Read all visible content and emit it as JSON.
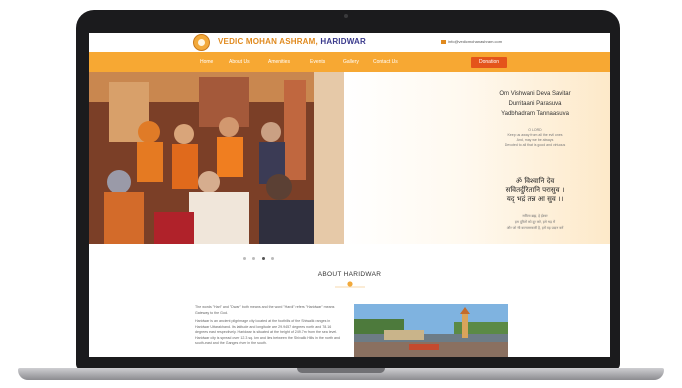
{
  "header": {
    "brand_main": "VEDIC MOHAN ASHRAM,",
    "brand_sub": " HARIDWAR",
    "email": "info@vedicmohanashram.com"
  },
  "nav": {
    "items": [
      "Home",
      "About Us",
      "Amenities",
      "Events",
      "Gallery",
      "Contact Us"
    ],
    "donate_label": "Donation"
  },
  "hero": {
    "mantra_english": [
      "Om Vishwani Deva Savitar",
      "Durritaani Parasuva",
      "Yadbhadram Tannaasuva"
    ],
    "meaning_lines": [
      "O LORD",
      "Keep us away from all the evil ones",
      "And, may we be always",
      "Devoted to all that is good and virtuous"
    ],
    "mantra_sanskrit": [
      "ॐ विश्वानि देव",
      "सवितर्दुरितानि परासुव ।",
      "यद् भद्रं तन्न आ सुव ।।"
    ],
    "sanskrit_meaning": [
      "सविता ब्रह्म, हे ईश्वर",
      "हम दूरितों को दूर करे, हमे भद्र में",
      "और जो भी कल्याणकारी है, हमें वह प्रदान करें"
    ]
  },
  "about": {
    "title": "ABOUT HARIDWAR",
    "paragraphs": [
      "The words \"Hari\" and \"Dwar\" both means and the word \"Hardi\" refers \"Haridwar\" means Gateway to the God.",
      "Haridwar is an ancient pilgrimage city located at the foothills of the Shiwalik ranges in Haridwar Uttarakhand. Its latitude and longitude are 29.9457 degrees north and 78.16 degrees east respectively. Haridwar is situated at the height of 249.7m from the sea level. Haridwar city is spread over 12.3 sq. km and lies between the Shivalik Hills in the north and south-east and the Ganges river in the south."
    ]
  },
  "colors": {
    "nav_bg": "#f7a833",
    "brand_orange": "#e08a1e",
    "donate_bg": "#e4541b",
    "brand_blue": "#3a3a8c"
  },
  "carousel": {
    "slide_count": 4,
    "active_slide": 3
  }
}
